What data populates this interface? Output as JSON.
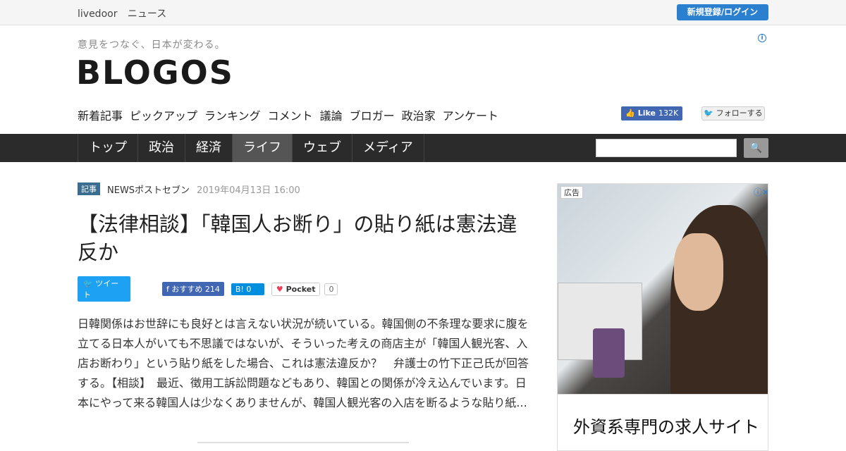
{
  "topbar": {
    "brand": "livedoor",
    "section": "ニュース",
    "login_label": "新規登録/ログイン"
  },
  "header": {
    "tagline": "意見をつなぐ、日本が変わる。",
    "logo": "BLOGOS",
    "ad_info_icon": "info-icon",
    "subnav": [
      "新着記事",
      "ピックアップ",
      "ランキング",
      "コメント",
      "議論",
      "ブロガー",
      "政治家",
      "アンケート"
    ],
    "fb_like": {
      "label": "Like",
      "count": "132K"
    },
    "twitter_follow": "フォローする"
  },
  "navbar": {
    "tabs": [
      {
        "label": "トップ"
      },
      {
        "label": "政治"
      },
      {
        "label": "経済"
      },
      {
        "label": "ライフ"
      },
      {
        "label": "ウェブ"
      },
      {
        "label": "メディア"
      }
    ],
    "active_tab": "ライフ",
    "search_placeholder": ""
  },
  "article": {
    "category": "記事",
    "source": "NEWSポストセブン",
    "date": "2019年04月13日 16:00",
    "title": "【法律相談】「韓国人お断り」の貼り紙は憲法違反か",
    "share": {
      "tweet": "ツイート",
      "facebook_label": "おすすめ",
      "facebook_count": "214",
      "hatena_count": "0",
      "pocket_label": "Pocket",
      "pocket_count": "0"
    },
    "body": "日韓関係はお世辞にも良好とは言えない状況が続いている。韓国側の不条理な要求に腹を立てる日本人がいても不思議ではないが、そういった考えの商店主が「韓国人観光客、入店お断わり」という貼り紙をした場合、これは憲法違反か？　弁護士の竹下正己氏が回答する。【相談】　最近、徴用工訴訟問題などもあり、韓国との関係が冷え込んでいます。日本にやって来る韓国人は少なくありませんが、韓国人観光客の入店を断るような貼り紙..."
  },
  "sidebar": {
    "ad_label": "広告",
    "ad_headline": "外資系専門の求人サイト"
  },
  "colors": {
    "accent": "#2a7fcf",
    "navbar": "#2b2b2b",
    "active_tab": "#555555"
  }
}
